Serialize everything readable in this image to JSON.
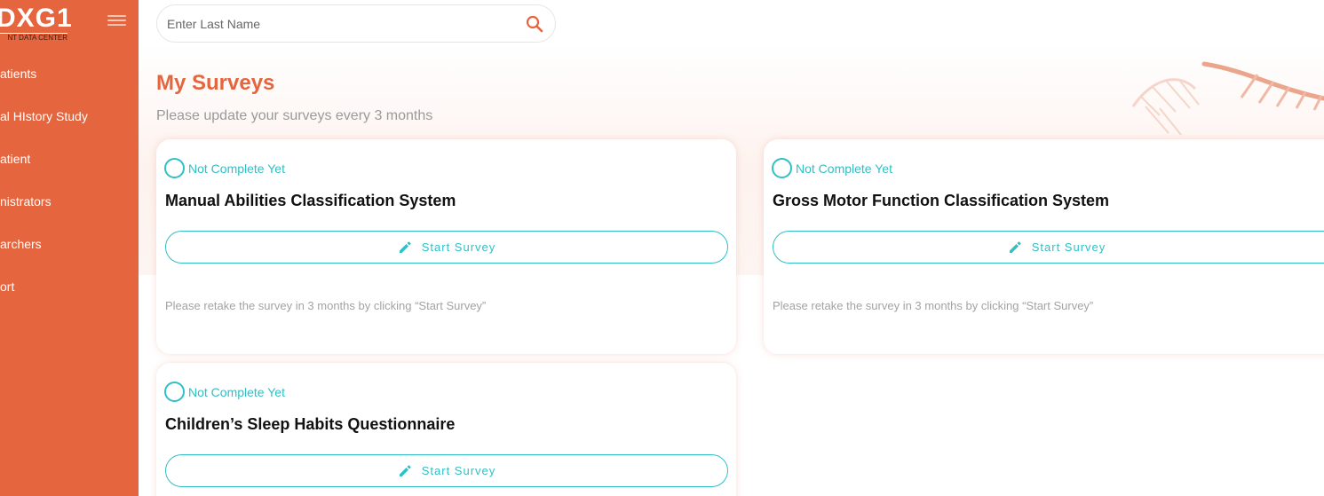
{
  "app": {
    "logo_main": "DXG1",
    "logo_sub": "NT DATA CENTER"
  },
  "sidebar": {
    "items": [
      {
        "label": "atients"
      },
      {
        "label": "al HIstory Study"
      },
      {
        "label": "atient"
      },
      {
        "label": "nistrators"
      },
      {
        "label": "archers"
      },
      {
        "label": "ort"
      }
    ]
  },
  "search": {
    "placeholder": "Enter Last Name",
    "value": ""
  },
  "page": {
    "title": "My Surveys",
    "subtitle": "Please update your surveys every 3 months"
  },
  "surveys": [
    {
      "status": "Not Complete Yet",
      "title": "Manual Abilities Classification System",
      "button": "Start Survey",
      "note": "Please retake the survey in 3 months by clicking “Start Survey”"
    },
    {
      "status": "Not Complete Yet",
      "title": "Gross Motor Function Classification System",
      "button": "Start Survey",
      "note": "Please retake the survey in 3 months by clicking “Start Survey”"
    },
    {
      "status": "Not Complete Yet",
      "title": "Children’s Sleep Habits Questionnaire",
      "button": "Start Survey"
    }
  ],
  "colors": {
    "brand": "#e5653e",
    "accent": "#2fc0c6",
    "muted_text": "#9a9a9a"
  },
  "icons": {
    "menu": "hamburger-menu-icon",
    "search": "search-icon",
    "status": "empty-circle-icon",
    "start": "pencil-icon",
    "decoration": "dna-helix-icon"
  }
}
